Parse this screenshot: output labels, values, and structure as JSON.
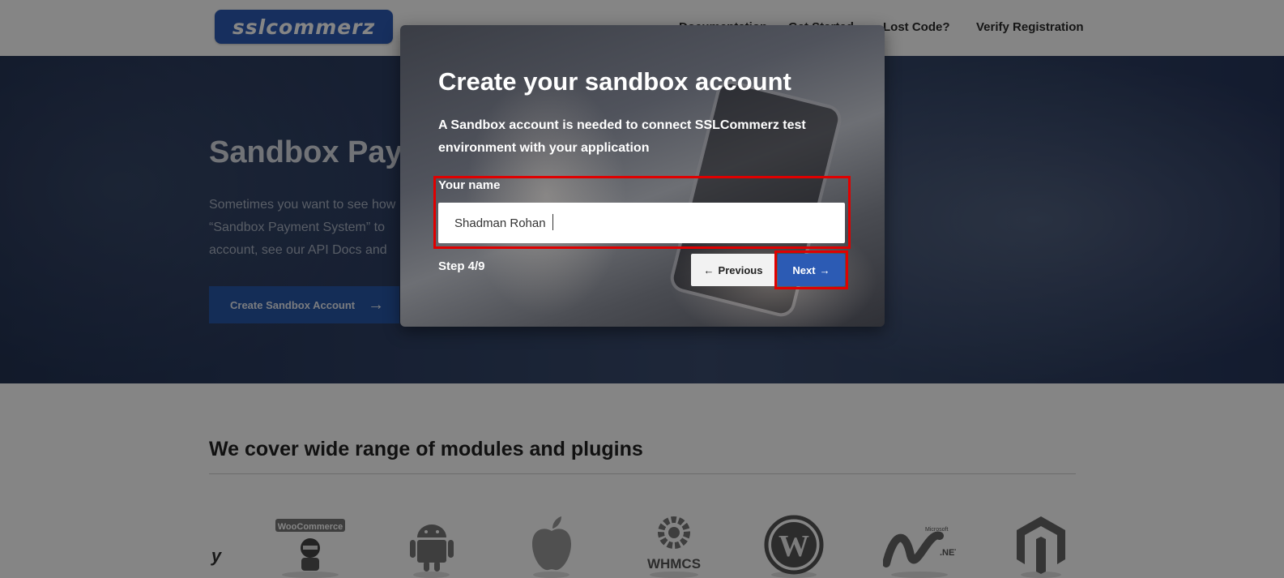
{
  "header": {
    "logo_text": "sslcommerz",
    "nav": [
      "Documentation",
      "Get Started",
      "Lost Code?",
      "Verify Registration"
    ]
  },
  "hero": {
    "title": "Sandbox Payment System",
    "text": "Sometimes you want to see how\n“Sandbox Payment System” to\naccount, see our API Docs and",
    "button_label": "Create Sandbox Account",
    "button_icon": "arrow-right-icon"
  },
  "section": {
    "title": "We cover wide range of modules and plugins",
    "plugins": [
      "y",
      "WooCommerce",
      "Android",
      "Apple",
      "WHMCS",
      "WordPress",
      "Microsoft .NET",
      "Magento"
    ]
  },
  "modal": {
    "title": "Create your sandbox account",
    "description": "A Sandbox account is needed to connect SSLCommerz test environment with your application",
    "field_label": "Your name",
    "field_value": "Shadman Rohan",
    "step": "Step 4/9",
    "prev_label": "Previous",
    "next_label": "Next",
    "prev_icon": "arrow-left-icon",
    "next_icon": "arrow-right-icon"
  },
  "colors": {
    "brand_blue": "#2c5bb4",
    "highlight_red": "#e00000"
  }
}
